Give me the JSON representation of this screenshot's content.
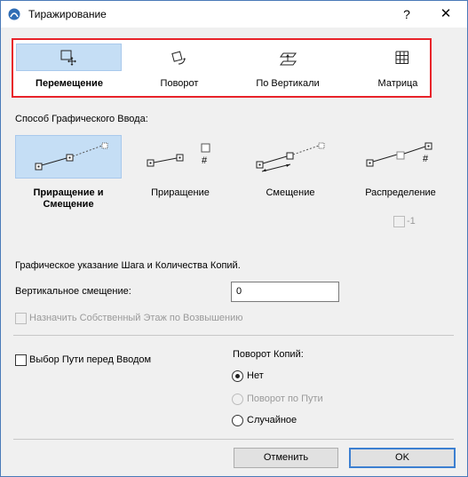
{
  "window": {
    "title": "Тиражирование",
    "help_label": "?",
    "close_label": "✕"
  },
  "tabs": [
    {
      "label": "Перемещение",
      "icon": "move-icon",
      "selected": true
    },
    {
      "label": "Поворот",
      "icon": "rotate-icon",
      "selected": false
    },
    {
      "label": "По Вертикали",
      "icon": "elevate-icon",
      "selected": false
    },
    {
      "label": "Матрица",
      "icon": "matrix-icon",
      "selected": false
    }
  ],
  "input_method": {
    "heading": "Способ Графического Ввода:",
    "modes": [
      {
        "line1": "Приращение и",
        "line2": "Смещение",
        "selected": true
      },
      {
        "line1": "Приращение",
        "line2": "",
        "selected": false,
        "hash": "#"
      },
      {
        "line1": "Смещение",
        "line2": "",
        "selected": false
      },
      {
        "line1": "Распределение",
        "line2": "",
        "selected": false,
        "hash": "#"
      }
    ],
    "minus_one_label": "-1"
  },
  "graphic_hint": "Графическое указание Шага и Количества Копий.",
  "vertical_offset": {
    "label": "Вертикальное смещение:",
    "value": "0"
  },
  "assign_story_label": "Назначить Собственный Этаж по Возвышению",
  "path_select_label": "Выбор Пути перед Вводом",
  "rotation": {
    "heading": "Поворот Копий:",
    "options": [
      {
        "label": "Нет",
        "checked": true,
        "disabled": false
      },
      {
        "label": "Поворот по Пути",
        "checked": false,
        "disabled": true
      },
      {
        "label": "Случайное",
        "checked": false,
        "disabled": false
      }
    ]
  },
  "buttons": {
    "cancel": "Отменить",
    "ok": "OK"
  },
  "colors": {
    "highlight_box": "#e8232a",
    "selection": "#c5def5",
    "default_button_border": "#3c7fd1"
  }
}
